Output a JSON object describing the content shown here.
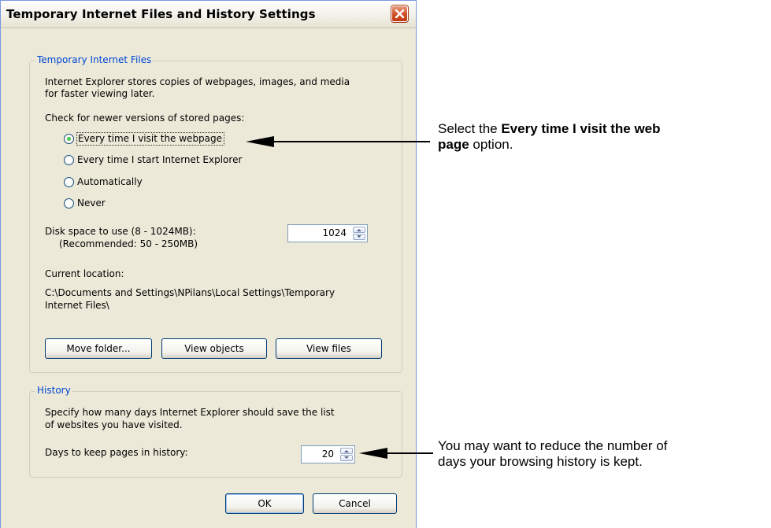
{
  "dialog": {
    "title": "Temporary Internet Files and History Settings",
    "close_icon": "close-x-icon"
  },
  "temp_files": {
    "legend": "Temporary Internet Files",
    "description_line1": "Internet Explorer stores copies of webpages, images, and media",
    "description_line2": "for faster viewing later.",
    "check_label": "Check for newer versions of stored pages:",
    "options": [
      {
        "label": "Every time I visit the webpage",
        "selected": true
      },
      {
        "label": "Every time I start Internet Explorer",
        "selected": false
      },
      {
        "label": "Automatically",
        "selected": false
      },
      {
        "label": "Never",
        "selected": false
      }
    ],
    "disk_label": "Disk space to use (8 - 1024MB):",
    "disk_recommended": "(Recommended: 50 - 250MB)",
    "disk_value": "1024",
    "location_label": "Current location:",
    "location_line1": "C:\\Documents and Settings\\NPilans\\Local Settings\\Temporary",
    "location_line2": "Internet Files\\",
    "buttons": {
      "move_folder": "Move folder...",
      "view_objects": "View objects",
      "view_files": "View files"
    }
  },
  "history": {
    "legend": "History",
    "description_line1": "Specify how many days Internet Explorer should save the list",
    "description_line2": "of websites you have visited.",
    "days_label": "Days to keep pages in history:",
    "days_value": "20"
  },
  "footer": {
    "ok": "OK",
    "cancel": "Cancel"
  },
  "annotations": {
    "note1_pre": "Select the ",
    "note1_bold_a": "Every time I visit the web",
    "note1_bold_b": "page",
    "note1_post": " option.",
    "note2_line1": "You may want to reduce the number of",
    "note2_line2": "days your browsing history is kept."
  },
  "colors": {
    "dialog_bg": "#ece9d8",
    "legend_text": "#0046d5",
    "button_border": "#003c74",
    "close_red": "#d04e25"
  }
}
